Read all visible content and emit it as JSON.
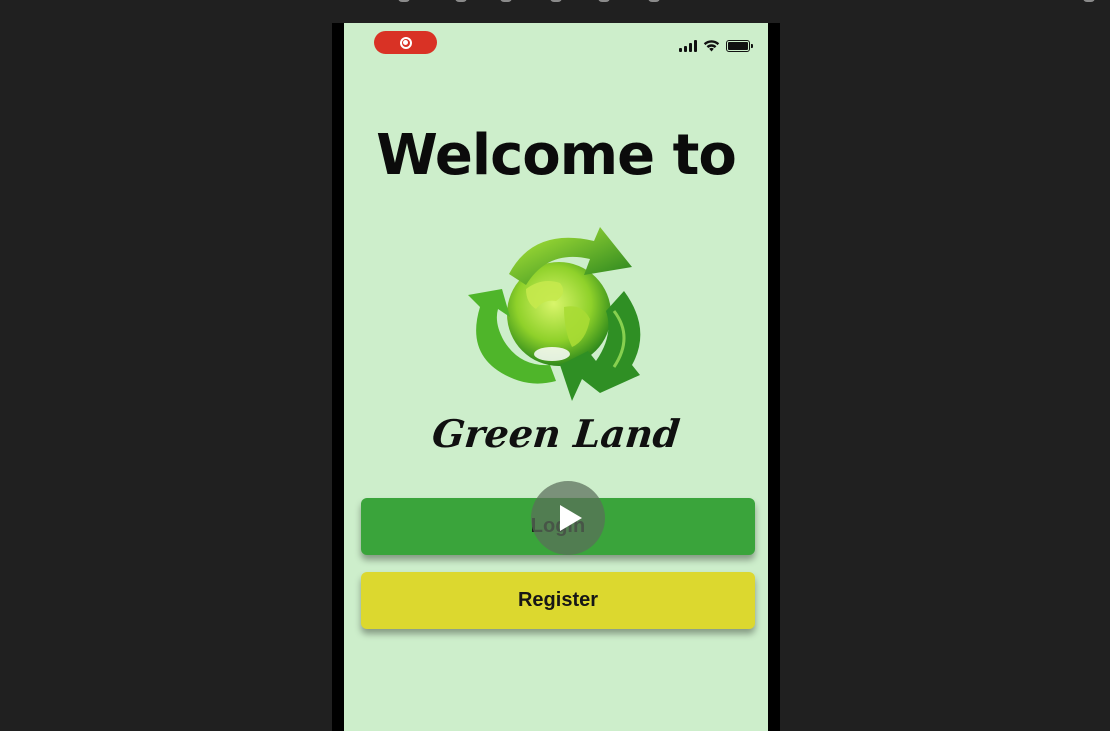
{
  "screen": {
    "welcome_text": "Welcome to",
    "brand_name": "Green Land",
    "login_label": "Login",
    "register_label": "Register"
  },
  "status_bar": {
    "icons": [
      "screen-record-icon",
      "cellular-signal-icon",
      "wifi-icon",
      "battery-icon"
    ]
  },
  "colors": {
    "background": "#202020",
    "screen_background": "#cdeecb",
    "record_pill": "#d93225",
    "login_button": "#3aa43b",
    "register_button": "#dcd82f"
  },
  "overlay": {
    "icon": "play-icon"
  }
}
